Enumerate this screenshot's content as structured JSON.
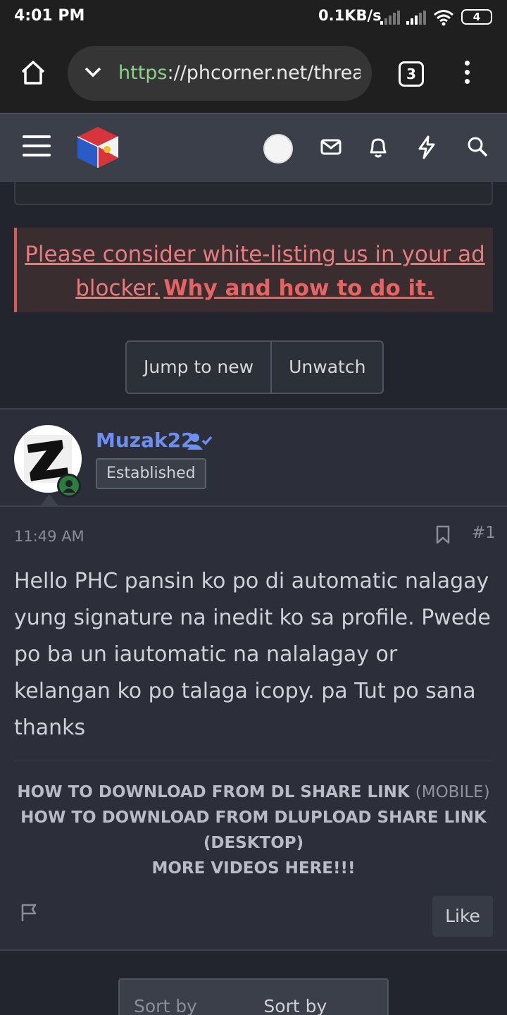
{
  "status": {
    "time": "4:01 PM",
    "speed": "0.1KB/s",
    "battery": "4"
  },
  "browser": {
    "url_scheme": "https",
    "url_rest": "://phcorner.net/threads",
    "tab_count": "3"
  },
  "notice": {
    "text": "Please consider white-listing us in your ad blocker.",
    "link": "Why and how to do it."
  },
  "actions": {
    "jump": "Jump to new",
    "unwatch": "Unwatch"
  },
  "post": {
    "username": "Muzak22",
    "rank": "Established",
    "time": "11:49 AM",
    "number": "#1",
    "body": "Hello PHC pansin ko po di automatic nalagay yung signature na inedit ko sa profile. Pwede po ba un iautomatic na nalalagay or kelangan ko po talaga icopy. pa Tut po sana thanks",
    "signature": {
      "line1": "HOW TO DOWNLOAD FROM DL SHARE LINK",
      "line1_suffix": "(MOBILE)",
      "line2": "HOW TO DOWNLOAD FROM DLUPLOAD SHARE LINK (DESKTOP)",
      "line3": "MORE VIDEOS HERE!!!"
    },
    "like": "Like"
  },
  "sort": {
    "by_date": "Sort by date",
    "by_votes": "Sort by votes"
  },
  "colors": {
    "accent": "#6f8ff0",
    "notice": "#e87c7c",
    "online": "#2d7d3e"
  }
}
